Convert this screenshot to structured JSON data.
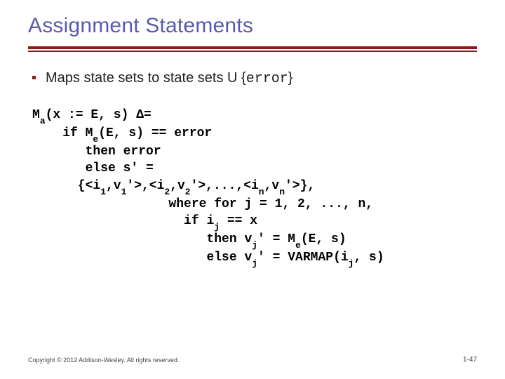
{
  "title": "Assignment Statements",
  "bullet": {
    "text_pre": "Maps state sets to state sets U {",
    "text_code": "error",
    "text_post": "}"
  },
  "code": {
    "l1_pre": "M",
    "l1_sub": "a",
    "l1_post": "(x := E, s) Δ=",
    "l2_pre": "    if M",
    "l2_sub": "e",
    "l2_post": "(E, s) == error",
    "l3": "       then error",
    "l4": "       else s' =",
    "l5_a": "      {<i",
    "l5_s1": "1",
    "l5_b": ",v",
    "l5_s2": "1",
    "l5_c": "'>,<i",
    "l5_s3": "2",
    "l5_d": ",v",
    "l5_s4": "2",
    "l5_e": "'>,...,<i",
    "l5_s5": "n",
    "l5_f": ",v",
    "l5_s6": "n",
    "l5_g": "'>},",
    "l6": "                  where for j = 1, 2, ..., n,",
    "l7_a": "                    if i",
    "l7_s1": "j",
    "l7_b": " == x",
    "l8_a": "                       then v",
    "l8_s1": "j",
    "l8_b": "' = M",
    "l8_s2": "e",
    "l8_c": "(E, s)",
    "l9_a": "                       else v",
    "l9_s1": "j",
    "l9_b": "' = VARMAP(i",
    "l9_s2": "j",
    "l9_c": ", s)"
  },
  "footer": "Copyright © 2012 Addison-Wesley. All rights reserved.",
  "pagenum": "1-47"
}
